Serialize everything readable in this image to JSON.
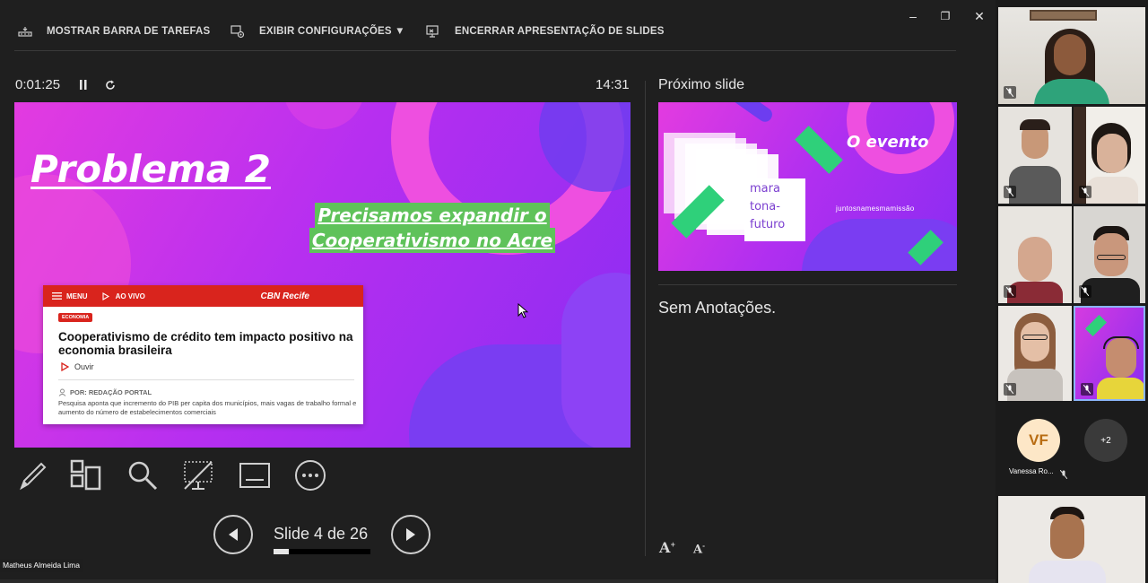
{
  "toolbar": {
    "taskbar_label": "MOSTRAR BARRA DE TAREFAS",
    "settings_label": "EXIBIR CONFIGURAÇÕES ▼",
    "end_label": "ENCERRAR APRESENTAÇÃO DE SLIDES"
  },
  "window_controls": {
    "minimize": "–",
    "restore": "❐",
    "close": "✕"
  },
  "timer": {
    "elapsed": "0:01:25",
    "clock": "14:31"
  },
  "next_slide_label": "Próximo slide",
  "current_slide": {
    "title": "Problema 2",
    "highlight_line1": "Precisamos expandir o",
    "highlight_line2": "Cooperativismo no Acre",
    "news": {
      "menu": "MENU",
      "live": "AO VIVO",
      "brand": "CBN Recife",
      "tag": "ECONOMIA",
      "headline": "Cooperativismo de crédito tem impacto positivo na economia brasileira",
      "listen": "Ouvir",
      "byline": "POR: REDAÇÃO PORTAL",
      "description": "Pesquisa aponta que incremento do PIB per capita dos municípios, mais vagas de trabalho formal e aumento do número de estabelecimentos comerciais"
    }
  },
  "next_slide": {
    "card_line1": "mara",
    "card_line2": "tona-",
    "card_line3": "futuro",
    "title": "O evento",
    "tagline": "juntosnamesmamissão"
  },
  "notes": "Sem Anotações.",
  "font_buttons": {
    "increase": "A",
    "decrease": "A"
  },
  "navigation": {
    "slide_text": "Slide 4 de 26",
    "current": 4,
    "total": 26,
    "progress_fraction": 0.154
  },
  "presenter_name": "Matheus Almeida Lima",
  "participants": {
    "vf_initials": "VF",
    "vf_name": "Vanessa Ro...",
    "more_count": "+2"
  },
  "colors": {
    "accent_green": "#5fc25a",
    "slide_pink": "#e33be0",
    "slide_purple": "#8a2cf2",
    "news_red": "#d9241d"
  }
}
